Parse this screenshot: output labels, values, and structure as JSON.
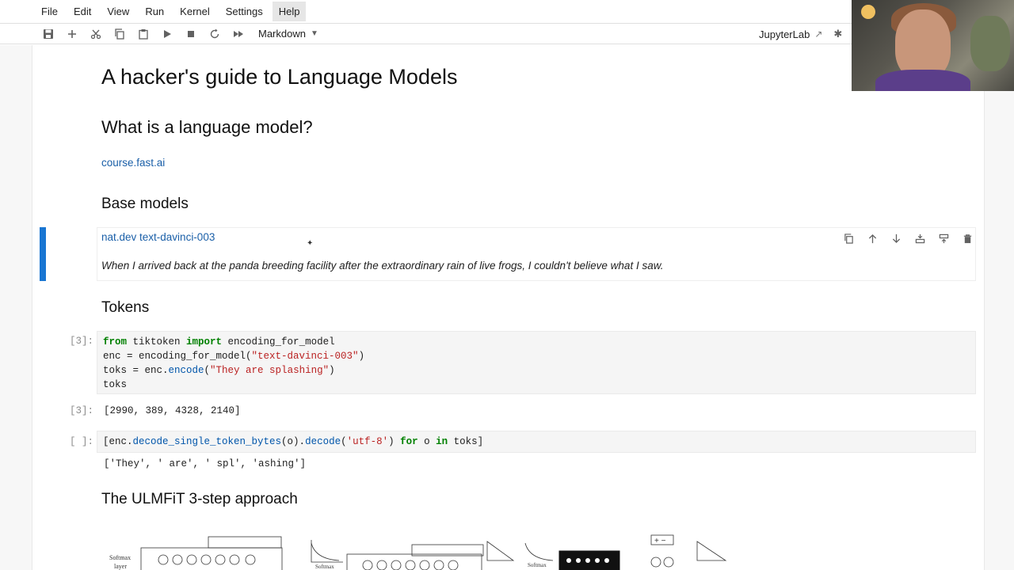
{
  "menubar": {
    "items": [
      "File",
      "Edit",
      "View",
      "Run",
      "Kernel",
      "Settings",
      "Help"
    ],
    "active": "Help"
  },
  "toolbar": {
    "icons": [
      "save-icon",
      "add-cell-icon",
      "cut-icon",
      "copy-icon",
      "paste-icon",
      "run-icon",
      "stop-icon",
      "restart-icon",
      "fast-forward-icon"
    ],
    "cell_type": "Markdown",
    "jupyterlab_label": "JupyterLab"
  },
  "notebook": {
    "title": "A hacker's guide to Language Models",
    "section_what": "What is a language model?",
    "course_link": "course.fast.ai",
    "section_base": "Base models",
    "natdev_link": "nat.dev text-davinci-003",
    "prompt_text": "When I arrived back at the panda breeding facility after the extraordinary rain of live frogs, I couldn't believe what I saw.",
    "section_tokens": "Tokens",
    "cell1": {
      "prompt": "[3]:",
      "lines": [
        "from tiktoken import encoding_for_model",
        "enc = encoding_for_model(\"text-davinci-003\")",
        "toks = enc.encode(\"They are splashing\")",
        "toks"
      ],
      "out_prompt": "[3]:",
      "output": "[2990, 389, 4328, 2140]"
    },
    "cell2": {
      "prompt": "[ ]:",
      "code": "[enc.decode_single_token_bytes(o).decode('utf-8') for o in toks]",
      "output": "['They', ' are', ' spl', 'ashing']"
    },
    "section_ulmfit": "The ULMFiT 3-step approach",
    "diagram_labels": [
      "Softmax",
      "layer",
      "Softmax",
      "Softmax"
    ]
  },
  "colors": {
    "active_bar": "#1976d2",
    "link": "#1a5fa8",
    "keyword": "#008000",
    "string": "#ba2121"
  }
}
